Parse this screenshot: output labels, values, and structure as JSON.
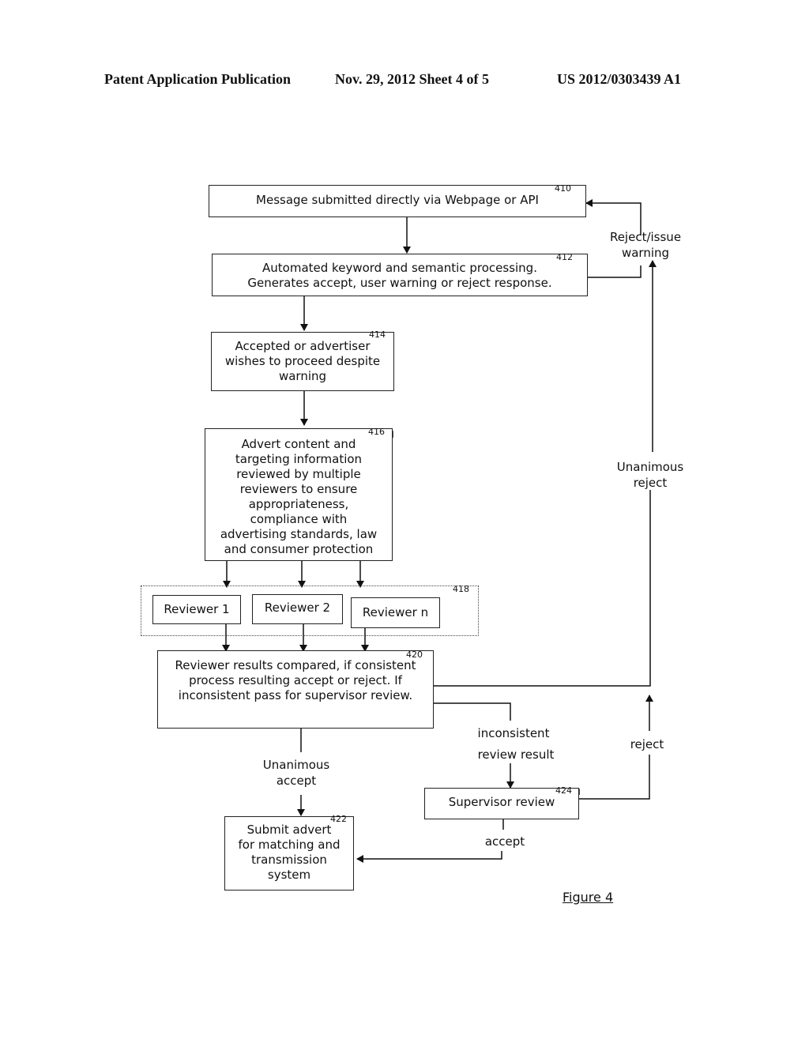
{
  "header": {
    "left": "Patent Application Publication",
    "middle": "Nov. 29, 2012   Sheet 4 of 5",
    "right": "US 2012/0303439 A1"
  },
  "boxes": {
    "b410": {
      "ref": "410",
      "text": "Message submitted directly via Webpage or API"
    },
    "b412": {
      "ref": "412",
      "text": "Automated keyword and semantic processing.\nGenerates accept, user warning or reject response."
    },
    "b414": {
      "ref": "414",
      "text": "Accepted or advertiser\nwishes to proceed despite\nwarning"
    },
    "b416": {
      "ref": "416",
      "text": "Advert content and\ntargeting information\nreviewed by multiple\nreviewers to ensure\nappropriateness,\ncompliance with\nadvertising standards, law\nand consumer protection"
    },
    "b418": {
      "ref": "418"
    },
    "reviewer1": {
      "text": "Reviewer 1"
    },
    "reviewer2": {
      "text": "Reviewer 2"
    },
    "reviewern": {
      "text": "Reviewer n"
    },
    "b420": {
      "ref": "420",
      "text": "Reviewer results compared, if consistent\nprocess resulting accept or reject. If\ninconsistent pass for supervisor review."
    },
    "b422": {
      "ref": "422",
      "text": "Submit advert\nfor matching and\ntransmission\nsystem"
    },
    "b424": {
      "ref": "424",
      "text": "Supervisor review"
    }
  },
  "labels": {
    "reject_warning": "Reject/issue\nwarning",
    "unanimous_reject": "Unanimous\nreject",
    "inconsistent": "inconsistent",
    "review_result": "review result",
    "reject": "reject",
    "unanimous_accept": "Unanimous\naccept",
    "accept": "accept"
  },
  "figure_caption": "Figure 4"
}
